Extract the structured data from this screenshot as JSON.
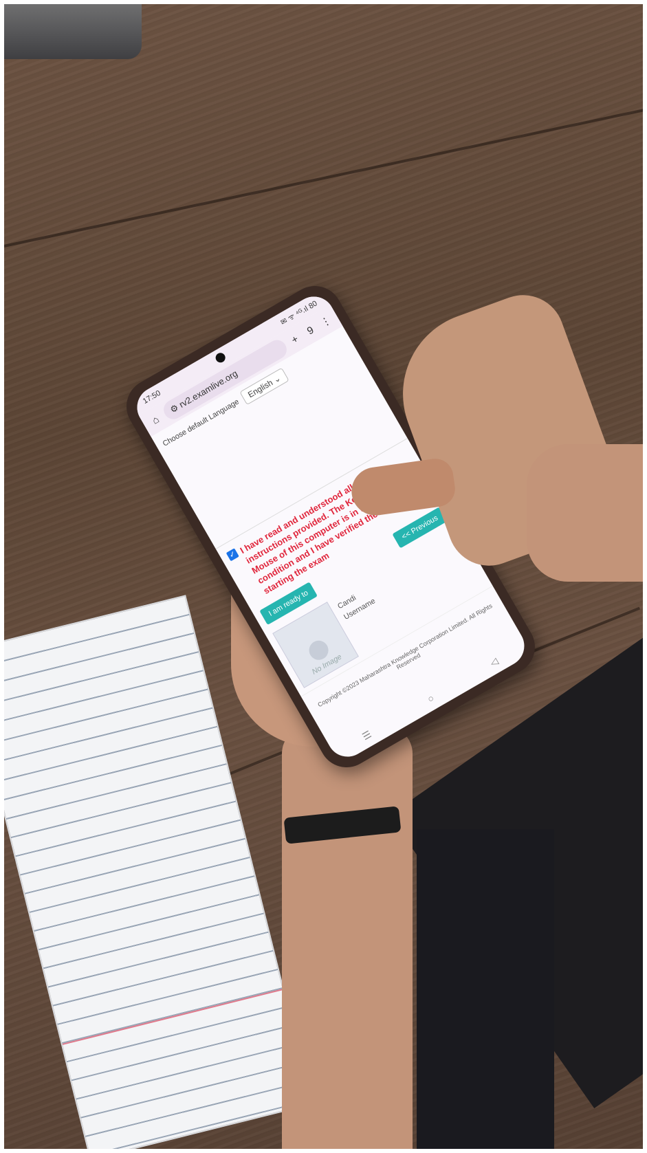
{
  "scene": {
    "description_tags": [
      "hands",
      "smartphone",
      "wooden-desk",
      "notebook",
      "wristband"
    ]
  },
  "phone": {
    "status": {
      "time": "17:50",
      "right_icons": "✉ ᯤ ⁴ᴳ.ıl 80"
    },
    "browser": {
      "url": "rv2.examlive.org",
      "tab_count": "9"
    },
    "language": {
      "label": "Choose default Language",
      "selected": "English"
    },
    "confirmation": {
      "text": "I have read and understood all the instructions provided. The Keyboard and Mouse of this computer is in working condition and I have verified the same before starting the exam",
      "checked": true
    },
    "buttons": {
      "ready": "I am ready to",
      "previous": "<< Previous"
    },
    "profile": {
      "avatar_caption": "No Image",
      "details": [
        "Candi",
        "Username"
      ]
    },
    "footer": {
      "copyright": "Copyright ©2023 Maharashtra Knowledge Corporation Limited. All Rights Reserved"
    }
  },
  "colors": {
    "accent_red": "#e0263c",
    "button_teal": "#26b5b0",
    "desk": "#5d4636"
  }
}
